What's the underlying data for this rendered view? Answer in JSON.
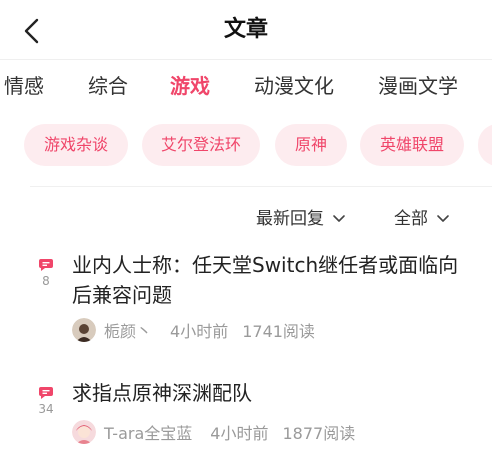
{
  "header": {
    "title": "文章"
  },
  "categories": [
    {
      "label": "情感",
      "active": false
    },
    {
      "label": "综合",
      "active": false
    },
    {
      "label": "游戏",
      "active": true
    },
    {
      "label": "动漫文化",
      "active": false
    },
    {
      "label": "漫画文学",
      "active": false
    }
  ],
  "tags": [
    {
      "label": "游戏杂谈"
    },
    {
      "label": "艾尔登法环"
    },
    {
      "label": "原神"
    },
    {
      "label": "英雄联盟"
    }
  ],
  "sort": {
    "order_label": "最新回复",
    "filter_label": "全部"
  },
  "posts": [
    {
      "reply_count": "8",
      "title": "业内人士称：任天堂Switch继任者或面临向后兼容问题",
      "author": "栀颜丶",
      "time": "4小时前",
      "views": "1741阅读"
    },
    {
      "reply_count": "34",
      "title": "求指点原神深渊配队",
      "author": "T-ara全宝蓝",
      "time": "4小时前",
      "views": "1877阅读"
    }
  ],
  "colors": {
    "accent": "#f0466a",
    "tag_bg": "#fdecef",
    "muted": "#9a9a9a"
  },
  "icons": {
    "back": "chevron-left-icon",
    "dropdown": "chevron-down-icon",
    "reply": "comment-bubble-icon"
  }
}
